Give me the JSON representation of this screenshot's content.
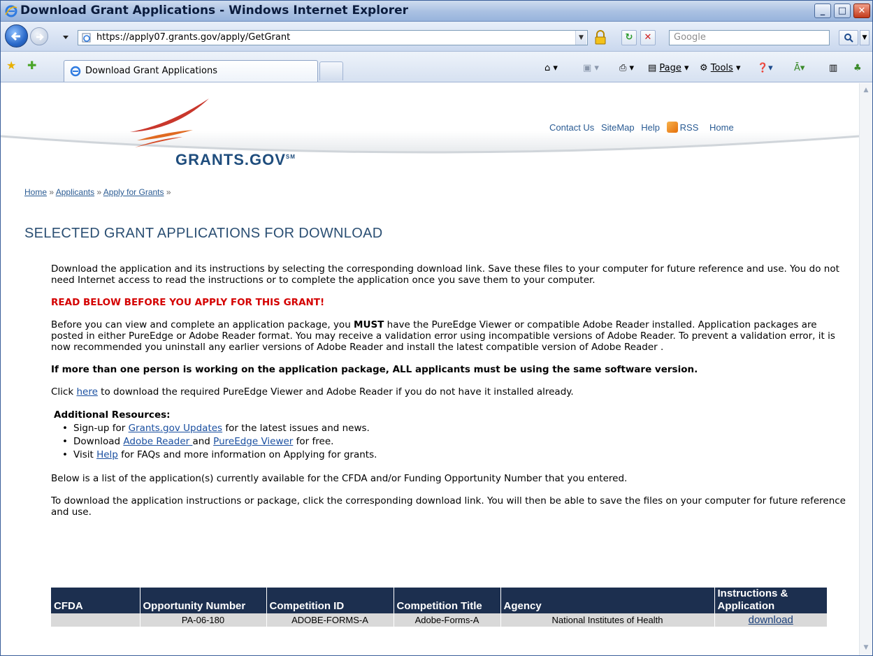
{
  "window": {
    "title": "Download Grant Applications - Windows Internet Explorer",
    "controls": {
      "minimize": "_",
      "maximize": "□",
      "close": "✕"
    }
  },
  "address_bar": {
    "url": "https://apply07.grants.gov/apply/GetGrant",
    "search_placeholder": "Google"
  },
  "tabs": [
    {
      "label": "Download Grant Applications",
      "active": true
    }
  ],
  "command_bar": {
    "page_label": "Page",
    "tools_label": "Tools"
  },
  "header": {
    "logo_text": "GRANTS.GOV",
    "logo_mark": "SM",
    "links": [
      "Contact Us",
      "SiteMap",
      "Help",
      "RSS",
      "Home"
    ]
  },
  "breadcrumb": {
    "items": [
      "Home",
      "Applicants",
      "Apply for Grants"
    ],
    "separator": "»"
  },
  "page": {
    "title": "SELECTED GRANT APPLICATIONS FOR DOWNLOAD",
    "intro": "Download the application and its instructions by selecting the corresponding download link. Save these files to your computer for future reference and use. You do not need Internet access to read the instructions or to complete the application once you save them to your computer.",
    "warning": "READ BELOW BEFORE YOU APPLY FOR THIS GRANT!",
    "requirements_pre": "Before you can view and complete an application package, you ",
    "requirements_must": "MUST",
    "requirements_post": " have the PureEdge Viewer or compatible Adobe Reader installed. Application packages are posted in either PureEdge or Adobe Reader format. You may receive a validation error using incompatible versions of Adobe Reader. To prevent a validation error, it is now recommended you uninstall any earlier versions of Adobe Reader and install the latest compatible version of Adobe Reader .",
    "same_version_notice": "If more than one person is working on the application package, ALL applicants must be using the same software version.",
    "click_pre": "Click ",
    "click_link": "here",
    "click_post": " to download the required PureEdge Viewer and Adobe Reader if you do not have it installed already.",
    "resources_heading": "Additional Resources:",
    "resources": [
      {
        "pre": "Sign-up for ",
        "link": "Grants.gov Updates",
        "post": " for the latest issues and news."
      },
      {
        "pre": "Download ",
        "link": "Adobe Reader ",
        "mid": "and ",
        "link2": "PureEdge Viewer",
        "post": " for free."
      },
      {
        "pre": "Visit ",
        "link": "Help",
        "post": " for FAQs and more information on Applying for grants."
      }
    ],
    "list_note": "Below is a list of the application(s) currently available for the CFDA and/or Funding Opportunity Number that you entered.",
    "download_note": "To download the application instructions or package, click the corresponding download link. You will then be able to save the files on your computer for future reference and use."
  },
  "table": {
    "headers": [
      "CFDA",
      "Opportunity Number",
      "Competition ID",
      "Competition Title",
      "Agency",
      "Instructions & Application"
    ],
    "rows": [
      [
        "",
        "PA-06-180",
        "ADOBE-FORMS-A",
        "Adobe-Forms-A",
        "National Institutes of Health",
        "download"
      ]
    ]
  }
}
